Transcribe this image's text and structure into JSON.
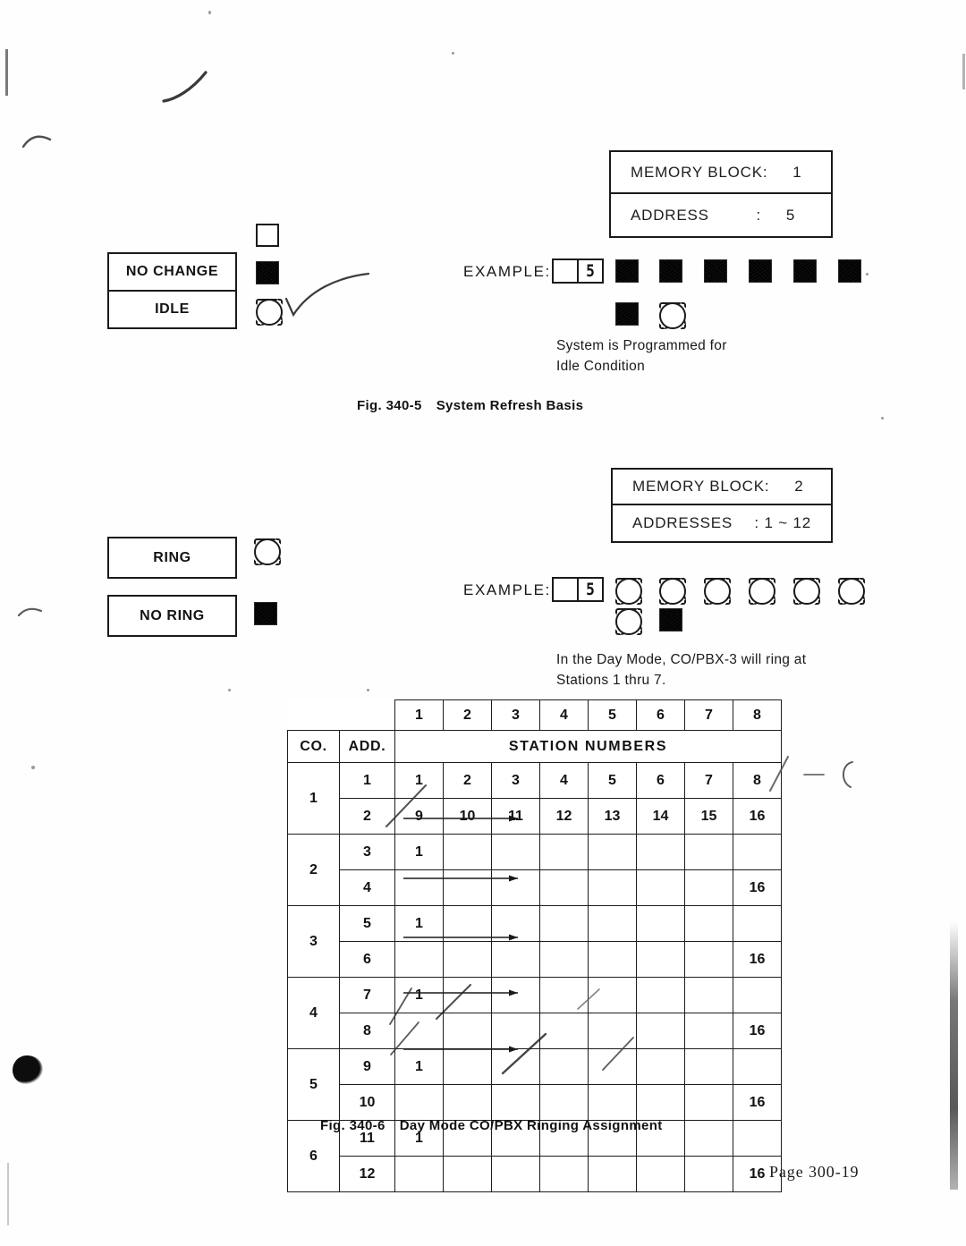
{
  "page": {
    "page_number": "Page  300-19"
  },
  "figure_5": {
    "memory_block": {
      "block_label": "MEMORY BLOCK",
      "block_colon": ":",
      "block_value": "1",
      "address_label": "ADDRESS",
      "address_colon": ":",
      "address_value": "5"
    },
    "legend": {
      "unlabeled_symbol": "empty-square",
      "items": [
        {
          "label": "NO CHANGE",
          "symbol": "dark-square"
        },
        {
          "label": "IDLE",
          "symbol": "circle-square"
        }
      ]
    },
    "example": {
      "label": "EXAMPLE:",
      "display_digit": "5",
      "row1_symbols": [
        "dark",
        "dark",
        "dark",
        "dark",
        "dark",
        "dark"
      ],
      "row2_symbols": [
        "dark",
        "circle"
      ]
    },
    "note": "System is Programmed for\nIdle Condition",
    "caption_number": "Fig. 340-5",
    "caption_title": "System Refresh Basis"
  },
  "figure_6": {
    "memory_block": {
      "block_label": "MEMORY BLOCK",
      "block_colon": ":",
      "block_value": "2",
      "address_label": "ADDRESSES",
      "address_colon": ":",
      "address_value": ": 1 ~ 12"
    },
    "legend": [
      {
        "label": "RING",
        "symbol": "circle-square"
      },
      {
        "label": "NO RING",
        "symbol": "dark-square"
      }
    ],
    "example": {
      "label": "EXAMPLE:",
      "display_digit": "5",
      "row1_symbols": [
        "circle",
        "circle",
        "circle",
        "circle",
        "circle",
        "circle"
      ],
      "row2_symbols": [
        "circle",
        "dark"
      ]
    },
    "note": "In the Day Mode, CO/PBX-3 will ring at\nStations 1 thru 7.",
    "caption_number": "Fig. 340-6",
    "caption_title": "Day Mode CO/PBX Ringing Assignment"
  },
  "table": {
    "top_header": [
      "1",
      "2",
      "3",
      "4",
      "5",
      "6",
      "7",
      "8"
    ],
    "co_header": "CO.",
    "add_header": "ADD.",
    "station_header": "STATION NUMBERS",
    "rows": [
      {
        "co": "1",
        "add": "1",
        "cells": [
          "1",
          "2",
          "3",
          "4",
          "5",
          "6",
          "7",
          "8"
        ]
      },
      {
        "co": "",
        "add": "2",
        "cells": [
          "9",
          "10",
          "11",
          "12",
          "13",
          "14",
          "15",
          "16"
        ]
      },
      {
        "co": "2",
        "add": "3",
        "cells": [
          "1",
          "",
          "",
          "",
          "",
          "",
          "",
          ""
        ]
      },
      {
        "co": "",
        "add": "4",
        "cells": [
          "",
          "",
          "",
          "",
          "",
          "",
          "",
          "16"
        ]
      },
      {
        "co": "3",
        "add": "5",
        "cells": [
          "1",
          "",
          "",
          "",
          "",
          "",
          "",
          ""
        ]
      },
      {
        "co": "",
        "add": "6",
        "cells": [
          "",
          "",
          "",
          "",
          "",
          "",
          "",
          "16"
        ]
      },
      {
        "co": "4",
        "add": "7",
        "cells": [
          "1",
          "",
          "",
          "",
          "",
          "",
          "",
          ""
        ]
      },
      {
        "co": "",
        "add": "8",
        "cells": [
          "",
          "",
          "",
          "",
          "",
          "",
          "",
          "16"
        ]
      },
      {
        "co": "5",
        "add": "9",
        "cells": [
          "1",
          "",
          "",
          "",
          "",
          "",
          "",
          ""
        ]
      },
      {
        "co": "",
        "add": "10",
        "cells": [
          "",
          "",
          "",
          "",
          "",
          "",
          "",
          "16"
        ]
      },
      {
        "co": "6",
        "add": "11",
        "cells": [
          "1",
          "",
          "",
          "",
          "",
          "",
          "",
          ""
        ]
      },
      {
        "co": "",
        "add": "12",
        "cells": [
          "",
          "",
          "",
          "",
          "",
          "",
          "",
          "16"
        ]
      }
    ]
  }
}
